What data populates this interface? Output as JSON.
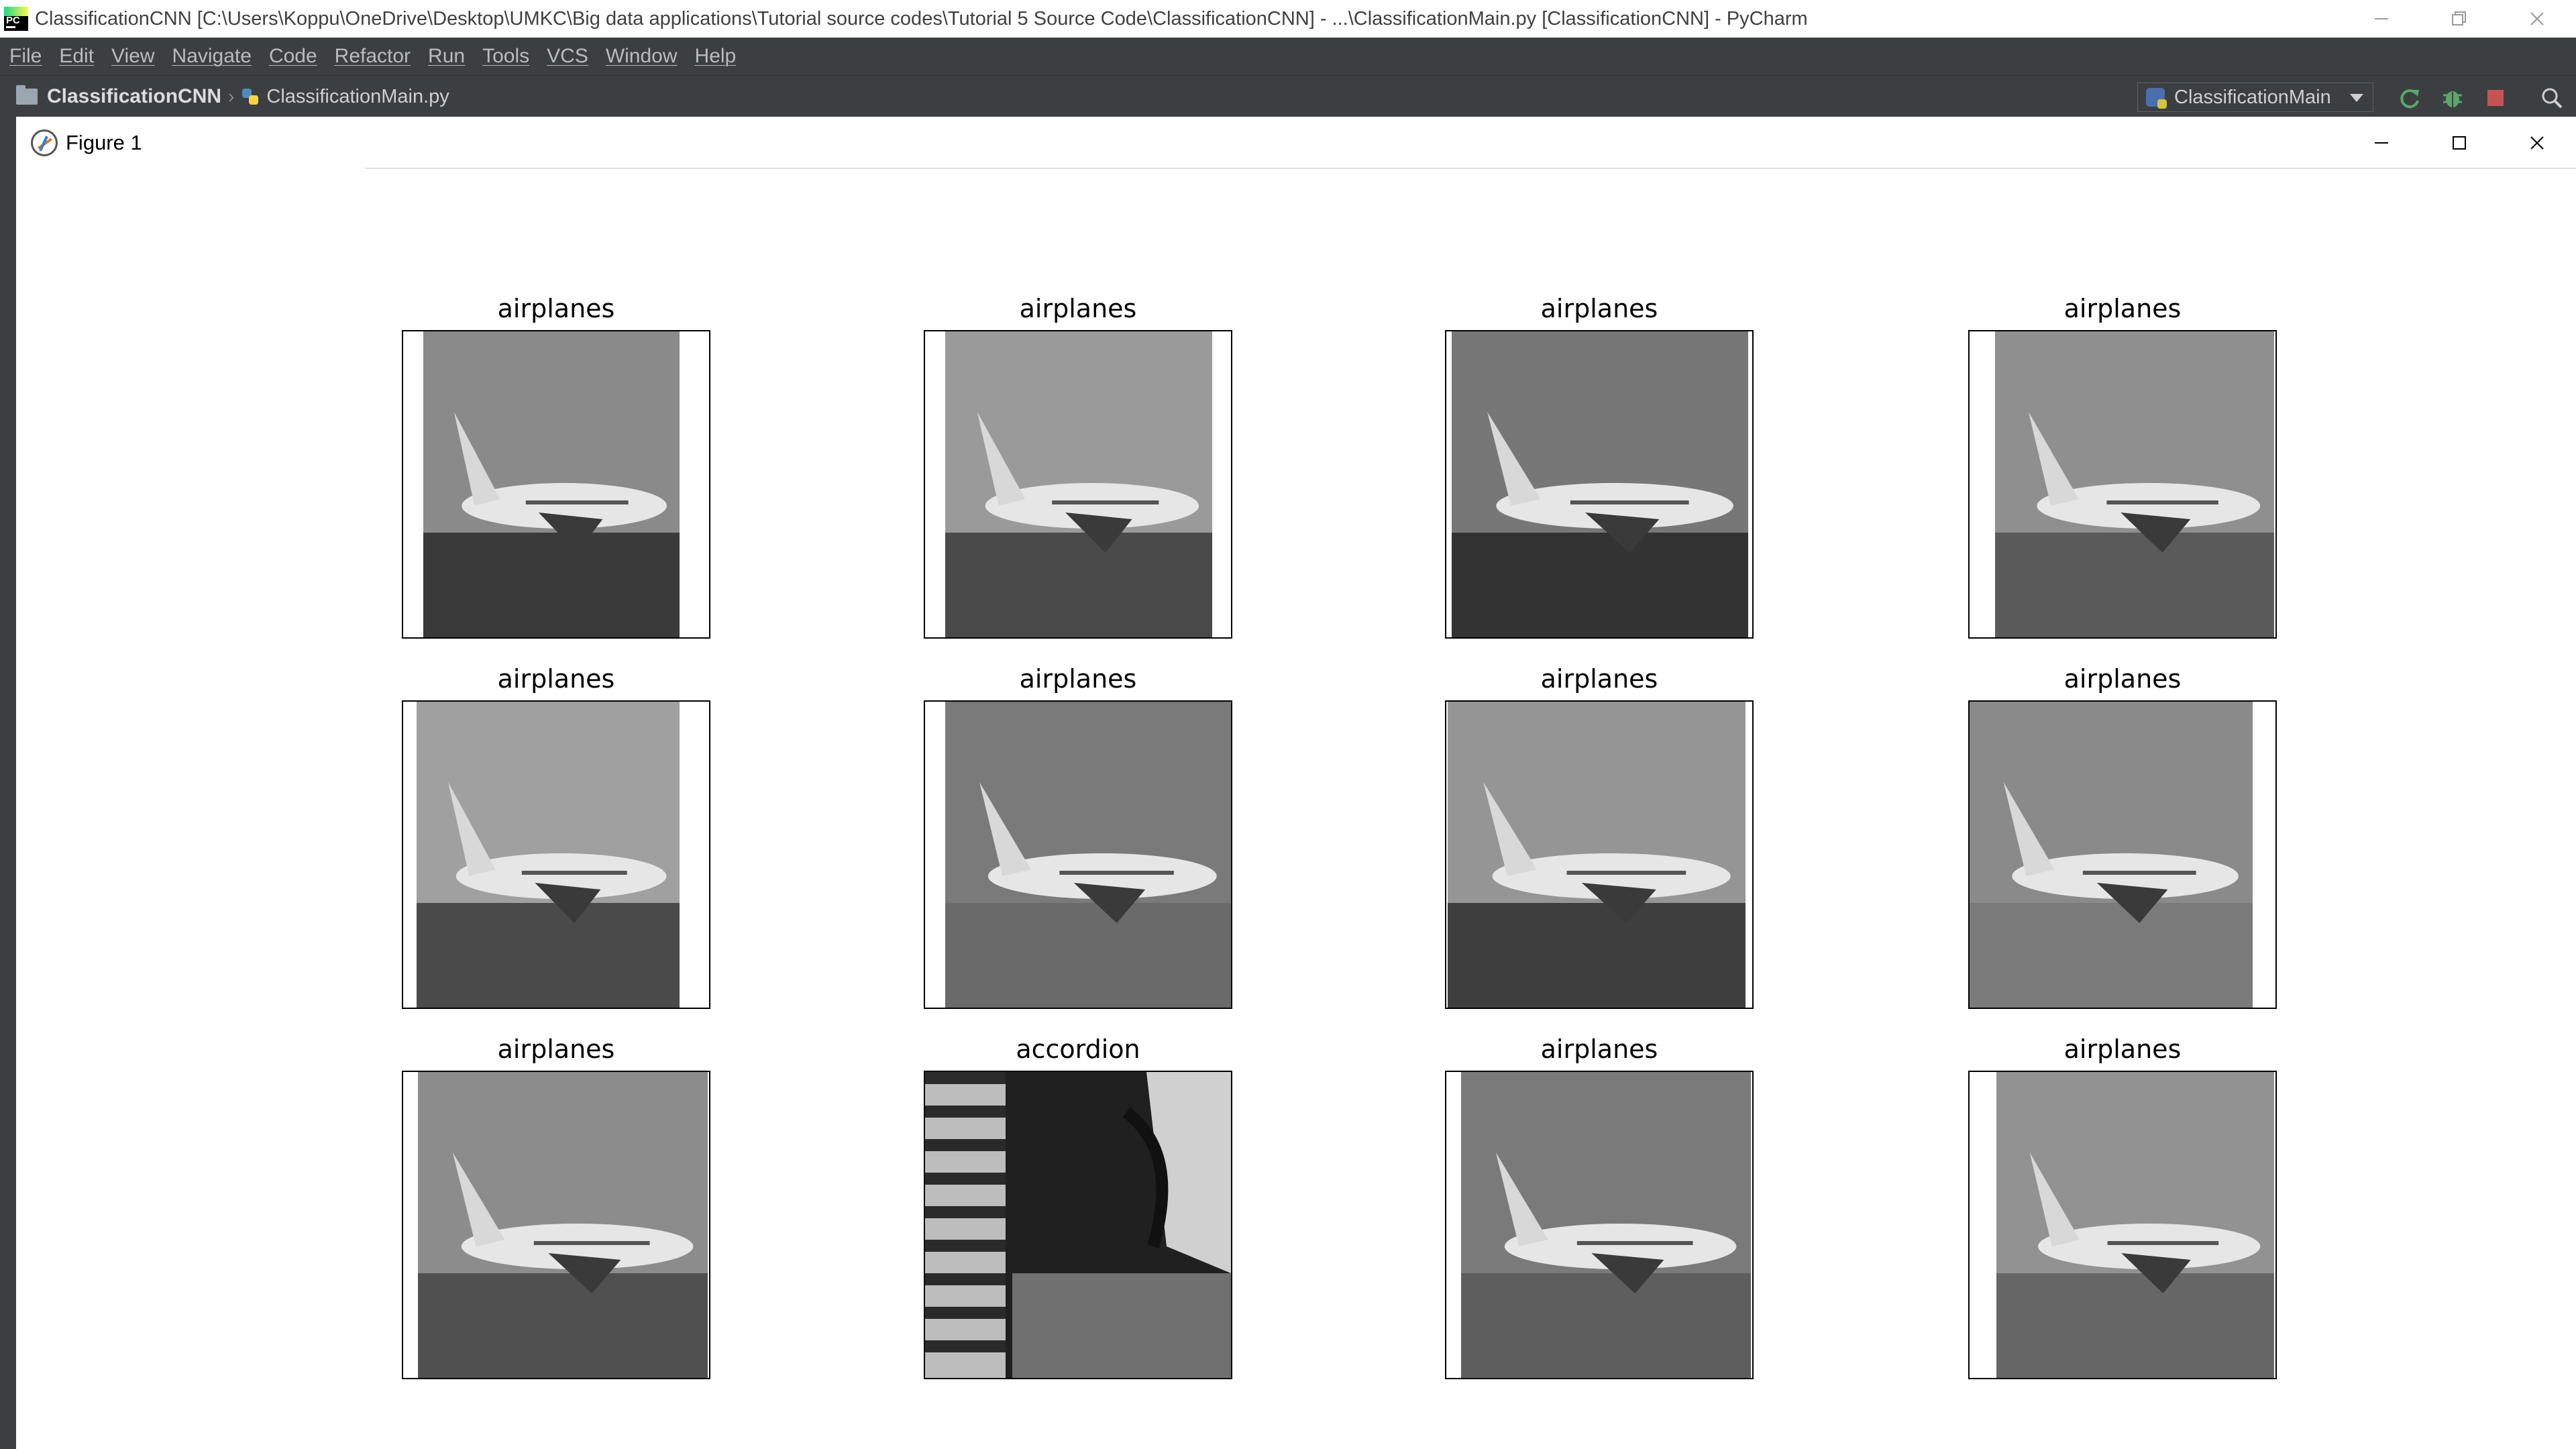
{
  "window": {
    "title": "ClassificationCNN [C:\\Users\\Koppu\\OneDrive\\Desktop\\UMKC\\Big data applications\\Tutorial source codes\\Tutorial 5 Source Code\\ClassificationCNN] - ...\\ClassificationMain.py [ClassificationCNN] - PyCharm",
    "logo_text": "PC"
  },
  "menu": [
    "File",
    "Edit",
    "View",
    "Navigate",
    "Code",
    "Refactor",
    "Run",
    "Tools",
    "VCS",
    "Window",
    "Help"
  ],
  "breadcrumb": {
    "project": "ClassificationCNN",
    "file": "ClassificationMain.py"
  },
  "run_config": {
    "selected": "ClassificationMain"
  },
  "figure": {
    "title": "Figure 1",
    "subplots": [
      {
        "label": "airplanes"
      },
      {
        "label": "airplanes"
      },
      {
        "label": "airplanes"
      },
      {
        "label": "airplanes"
      },
      {
        "label": "airplanes"
      },
      {
        "label": "airplanes"
      },
      {
        "label": "airplanes"
      },
      {
        "label": "airplanes"
      },
      {
        "label": "airplanes"
      },
      {
        "label": "accordion"
      },
      {
        "label": "airplanes"
      },
      {
        "label": "airplanes"
      }
    ]
  },
  "colors": {
    "ide_dark": "#3c3f41",
    "figure_bg": "#ffffff",
    "stop_red": "#c75450",
    "rerun_green": "#59a869"
  }
}
